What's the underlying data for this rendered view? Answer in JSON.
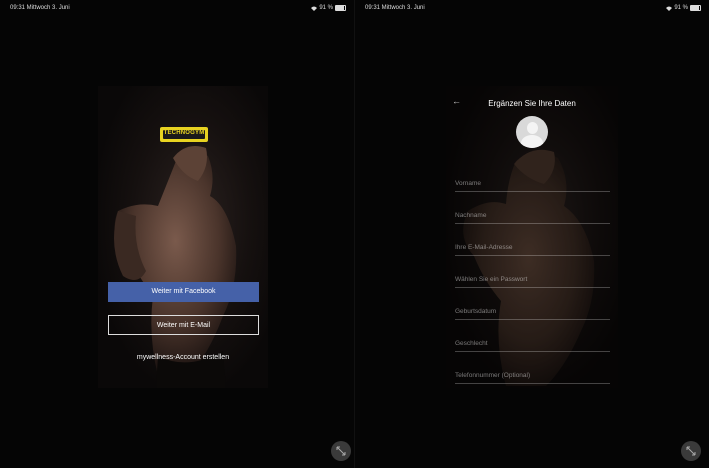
{
  "left_screen": {
    "status_time": "09:31  Mittwoch 3. Juni",
    "status_battery": "91 %",
    "logo_text": "TECHNOGYM",
    "facebook_button": "Weiter mit Facebook",
    "email_button": "Weiter mit E-Mail",
    "create_account_link": "mywellness-Account erstellen"
  },
  "right_screen": {
    "status_time": "09:31  Mittwoch 3. Juni",
    "status_battery": "91 %",
    "title": "Ergänzen Sie Ihre Daten",
    "fields": [
      "Vorname",
      "Nachname",
      "Ihre E-Mail-Adresse",
      "Wählen Sie ein Passwort",
      "Geburtsdatum",
      "Geschlecht",
      "Telefonnummer (Optional)"
    ]
  },
  "colors": {
    "facebook_blue": "#4561a8",
    "logo_yellow": "#e8d321",
    "background": "#000000"
  },
  "icons": [
    "back-arrow-icon",
    "avatar-placeholder-icon",
    "expand-icon",
    "wifi-icon",
    "battery-icon"
  ]
}
